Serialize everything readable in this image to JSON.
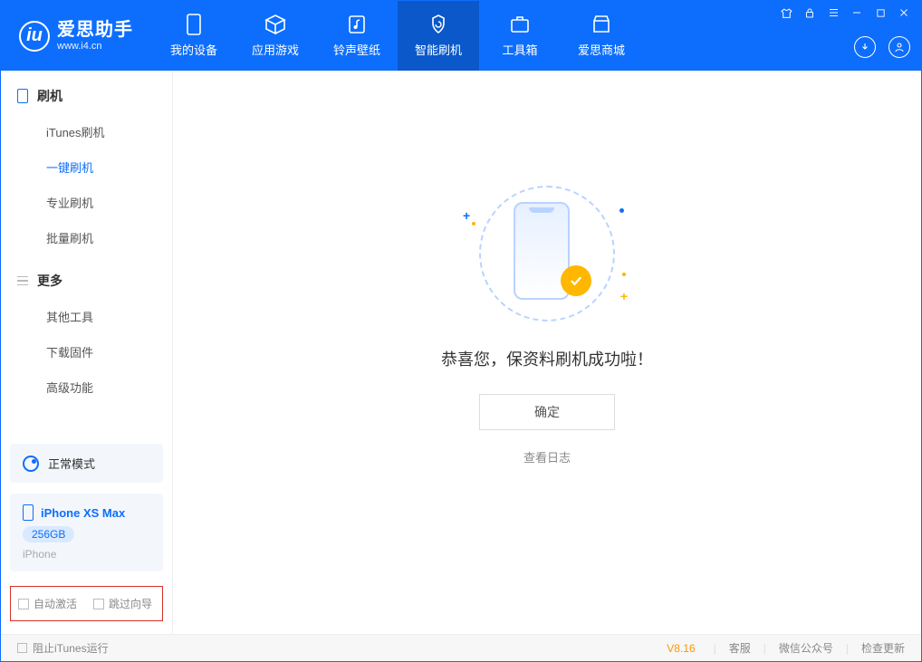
{
  "logo": {
    "cn": "爱思助手",
    "url": "www.i4.cn"
  },
  "nav": [
    {
      "label": "我的设备"
    },
    {
      "label": "应用游戏"
    },
    {
      "label": "铃声壁纸"
    },
    {
      "label": "智能刷机"
    },
    {
      "label": "工具箱"
    },
    {
      "label": "爱思商城"
    }
  ],
  "sidebar": {
    "section1": "刷机",
    "items1": [
      "iTunes刷机",
      "一键刷机",
      "专业刷机",
      "批量刷机"
    ],
    "section2": "更多",
    "items2": [
      "其他工具",
      "下载固件",
      "高级功能"
    ]
  },
  "mode_card": "正常模式",
  "device": {
    "name": "iPhone XS Max",
    "storage": "256GB",
    "type": "iPhone"
  },
  "checks": {
    "auto_activate": "自动激活",
    "skip_guide": "跳过向导"
  },
  "main": {
    "message": "恭喜您，保资料刷机成功啦！",
    "ok": "确定",
    "log": "查看日志"
  },
  "footer": {
    "block_itunes": "阻止iTunes运行",
    "version": "V8.16",
    "links": [
      "客服",
      "微信公众号",
      "检查更新"
    ]
  }
}
